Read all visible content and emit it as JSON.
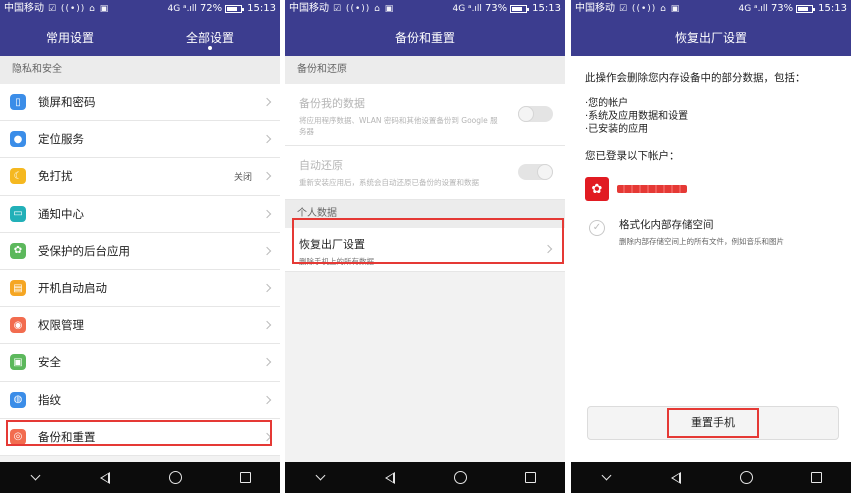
{
  "status": {
    "s1": {
      "carrier": "中国移动",
      "icons": "☑ ((•)) ⌂ ▣",
      "network": "4G ᵃ.ıll",
      "battery": "72%",
      "battery_level": 0.72,
      "time": "15:13"
    },
    "s2": {
      "carrier": "中国移动",
      "icons": "☑ ((•)) ⌂ ▣",
      "network": "4G ᵃ.ıll",
      "battery": "73%",
      "battery_level": 0.73,
      "time": "15:13"
    },
    "s3": {
      "carrier": "中国移动",
      "icons": "☑ ((•)) ⌂ ▣",
      "network": "4G ᵃ.ıll",
      "battery": "73%",
      "battery_level": 0.73,
      "time": "15:13"
    }
  },
  "screen1": {
    "tabs": [
      "常用设置",
      "全部设置"
    ],
    "active_tab": 1,
    "section": "隐私和安全",
    "items": [
      {
        "label": "锁屏和密码",
        "icon": "lock-screen-icon",
        "color": "#3b8de8",
        "glyph": "▯",
        "value": ""
      },
      {
        "label": "定位服务",
        "icon": "location-icon",
        "color": "#3b8de8",
        "glyph": "●",
        "value": ""
      },
      {
        "label": "免打扰",
        "icon": "moon-icon",
        "color": "#f5b820",
        "glyph": "☾",
        "value": "关闭"
      },
      {
        "label": "通知中心",
        "icon": "notification-icon",
        "color": "#22b0b8",
        "glyph": "▭",
        "value": ""
      },
      {
        "label": "受保护的后台应用",
        "icon": "protected-apps-icon",
        "color": "#5cb85c",
        "glyph": "✿",
        "value": ""
      },
      {
        "label": "开机自动启动",
        "icon": "auto-start-icon",
        "color": "#f5a623",
        "glyph": "▤",
        "value": ""
      },
      {
        "label": "权限管理",
        "icon": "permission-icon",
        "color": "#f26c4f",
        "glyph": "◉",
        "value": ""
      },
      {
        "label": "安全",
        "icon": "security-lock-icon",
        "color": "#5cb85c",
        "glyph": "▣",
        "value": ""
      },
      {
        "label": "指纹",
        "icon": "fingerprint-icon",
        "color": "#3b8de8",
        "glyph": "◍",
        "value": ""
      },
      {
        "label": "备份和重置",
        "icon": "backup-reset-icon",
        "color": "#f26c4f",
        "glyph": "◎",
        "value": ""
      }
    ]
  },
  "screen2": {
    "title": "备份和重置",
    "section_backup": "备份和还原",
    "backup_my_data": {
      "title": "备份我的数据",
      "sub": "将应用程序数据、WLAN 密码和其他设置备份到 Google 服务器"
    },
    "auto_restore": {
      "title": "自动还原",
      "sub": "重新安装应用后，系统会自动还原已备份的设置和数据"
    },
    "section_personal": "个人数据",
    "factory_reset": {
      "title": "恢复出厂设置",
      "sub": "删除手机上的所有数据"
    }
  },
  "screen3": {
    "title": "恢复出厂设置",
    "warning": "此操作会删除您内存设备中的部分数据，包括：",
    "bullets": [
      "·您的帐户",
      "·系统及应用数据和设置",
      "·已安装的应用"
    ],
    "accounts_title": "您已登录以下帐户：",
    "format_title": "格式化内部存储空间",
    "format_sub": "删除内部存储空间上的所有文件，例如音乐和图片",
    "reset_button": "重置手机"
  },
  "nav": {
    "down": "down-arrow-icon",
    "back": "back-icon",
    "home": "home-icon",
    "recent": "recent-apps-icon"
  }
}
